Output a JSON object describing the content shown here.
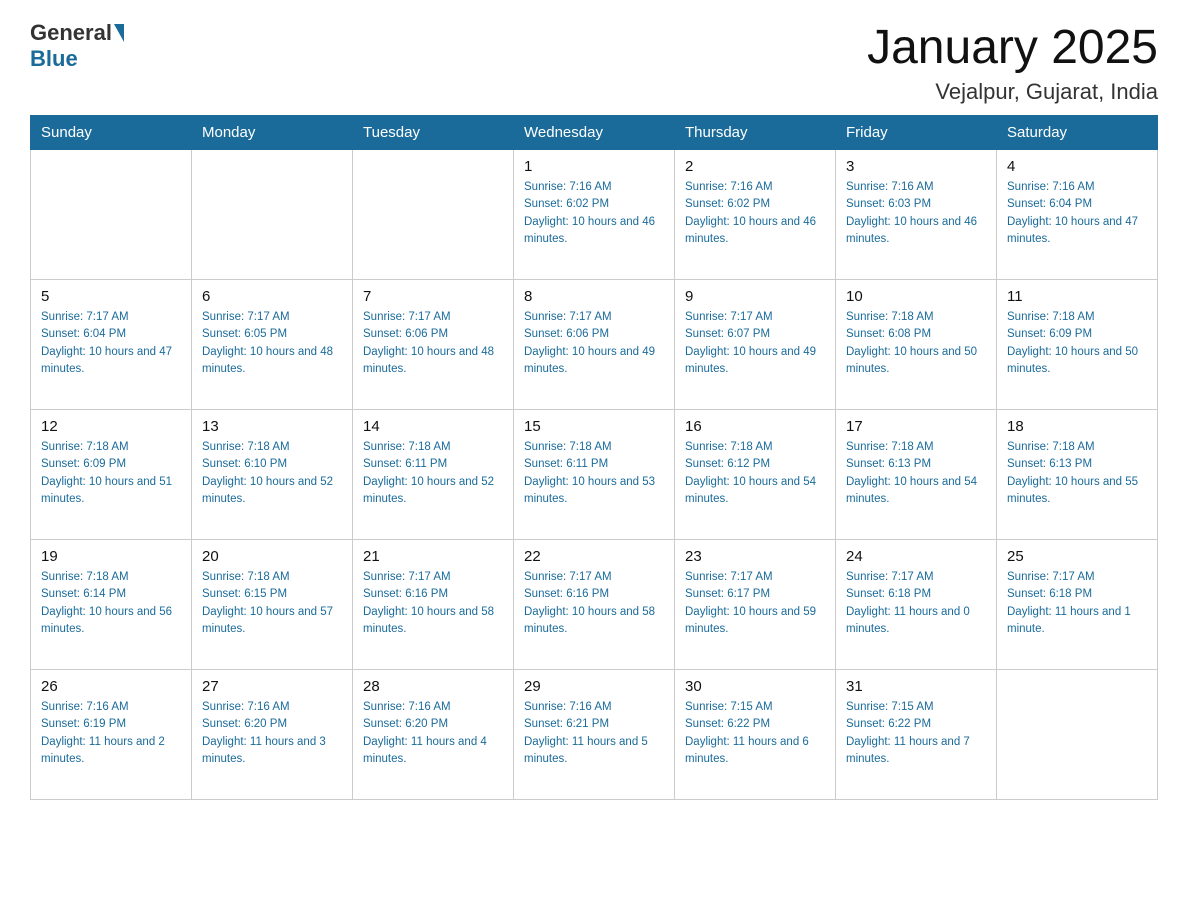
{
  "header": {
    "logo": {
      "general": "General",
      "blue": "Blue"
    },
    "title": "January 2025",
    "subtitle": "Vejalpur, Gujarat, India"
  },
  "days_of_week": [
    "Sunday",
    "Monday",
    "Tuesday",
    "Wednesday",
    "Thursday",
    "Friday",
    "Saturday"
  ],
  "weeks": [
    [
      {
        "day": "",
        "info": ""
      },
      {
        "day": "",
        "info": ""
      },
      {
        "day": "",
        "info": ""
      },
      {
        "day": "1",
        "info": "Sunrise: 7:16 AM\nSunset: 6:02 PM\nDaylight: 10 hours and 46 minutes."
      },
      {
        "day": "2",
        "info": "Sunrise: 7:16 AM\nSunset: 6:02 PM\nDaylight: 10 hours and 46 minutes."
      },
      {
        "day": "3",
        "info": "Sunrise: 7:16 AM\nSunset: 6:03 PM\nDaylight: 10 hours and 46 minutes."
      },
      {
        "day": "4",
        "info": "Sunrise: 7:16 AM\nSunset: 6:04 PM\nDaylight: 10 hours and 47 minutes."
      }
    ],
    [
      {
        "day": "5",
        "info": "Sunrise: 7:17 AM\nSunset: 6:04 PM\nDaylight: 10 hours and 47 minutes."
      },
      {
        "day": "6",
        "info": "Sunrise: 7:17 AM\nSunset: 6:05 PM\nDaylight: 10 hours and 48 minutes."
      },
      {
        "day": "7",
        "info": "Sunrise: 7:17 AM\nSunset: 6:06 PM\nDaylight: 10 hours and 48 minutes."
      },
      {
        "day": "8",
        "info": "Sunrise: 7:17 AM\nSunset: 6:06 PM\nDaylight: 10 hours and 49 minutes."
      },
      {
        "day": "9",
        "info": "Sunrise: 7:17 AM\nSunset: 6:07 PM\nDaylight: 10 hours and 49 minutes."
      },
      {
        "day": "10",
        "info": "Sunrise: 7:18 AM\nSunset: 6:08 PM\nDaylight: 10 hours and 50 minutes."
      },
      {
        "day": "11",
        "info": "Sunrise: 7:18 AM\nSunset: 6:09 PM\nDaylight: 10 hours and 50 minutes."
      }
    ],
    [
      {
        "day": "12",
        "info": "Sunrise: 7:18 AM\nSunset: 6:09 PM\nDaylight: 10 hours and 51 minutes."
      },
      {
        "day": "13",
        "info": "Sunrise: 7:18 AM\nSunset: 6:10 PM\nDaylight: 10 hours and 52 minutes."
      },
      {
        "day": "14",
        "info": "Sunrise: 7:18 AM\nSunset: 6:11 PM\nDaylight: 10 hours and 52 minutes."
      },
      {
        "day": "15",
        "info": "Sunrise: 7:18 AM\nSunset: 6:11 PM\nDaylight: 10 hours and 53 minutes."
      },
      {
        "day": "16",
        "info": "Sunrise: 7:18 AM\nSunset: 6:12 PM\nDaylight: 10 hours and 54 minutes."
      },
      {
        "day": "17",
        "info": "Sunrise: 7:18 AM\nSunset: 6:13 PM\nDaylight: 10 hours and 54 minutes."
      },
      {
        "day": "18",
        "info": "Sunrise: 7:18 AM\nSunset: 6:13 PM\nDaylight: 10 hours and 55 minutes."
      }
    ],
    [
      {
        "day": "19",
        "info": "Sunrise: 7:18 AM\nSunset: 6:14 PM\nDaylight: 10 hours and 56 minutes."
      },
      {
        "day": "20",
        "info": "Sunrise: 7:18 AM\nSunset: 6:15 PM\nDaylight: 10 hours and 57 minutes."
      },
      {
        "day": "21",
        "info": "Sunrise: 7:17 AM\nSunset: 6:16 PM\nDaylight: 10 hours and 58 minutes."
      },
      {
        "day": "22",
        "info": "Sunrise: 7:17 AM\nSunset: 6:16 PM\nDaylight: 10 hours and 58 minutes."
      },
      {
        "day": "23",
        "info": "Sunrise: 7:17 AM\nSunset: 6:17 PM\nDaylight: 10 hours and 59 minutes."
      },
      {
        "day": "24",
        "info": "Sunrise: 7:17 AM\nSunset: 6:18 PM\nDaylight: 11 hours and 0 minutes."
      },
      {
        "day": "25",
        "info": "Sunrise: 7:17 AM\nSunset: 6:18 PM\nDaylight: 11 hours and 1 minute."
      }
    ],
    [
      {
        "day": "26",
        "info": "Sunrise: 7:16 AM\nSunset: 6:19 PM\nDaylight: 11 hours and 2 minutes."
      },
      {
        "day": "27",
        "info": "Sunrise: 7:16 AM\nSunset: 6:20 PM\nDaylight: 11 hours and 3 minutes."
      },
      {
        "day": "28",
        "info": "Sunrise: 7:16 AM\nSunset: 6:20 PM\nDaylight: 11 hours and 4 minutes."
      },
      {
        "day": "29",
        "info": "Sunrise: 7:16 AM\nSunset: 6:21 PM\nDaylight: 11 hours and 5 minutes."
      },
      {
        "day": "30",
        "info": "Sunrise: 7:15 AM\nSunset: 6:22 PM\nDaylight: 11 hours and 6 minutes."
      },
      {
        "day": "31",
        "info": "Sunrise: 7:15 AM\nSunset: 6:22 PM\nDaylight: 11 hours and 7 minutes."
      },
      {
        "day": "",
        "info": ""
      }
    ]
  ]
}
